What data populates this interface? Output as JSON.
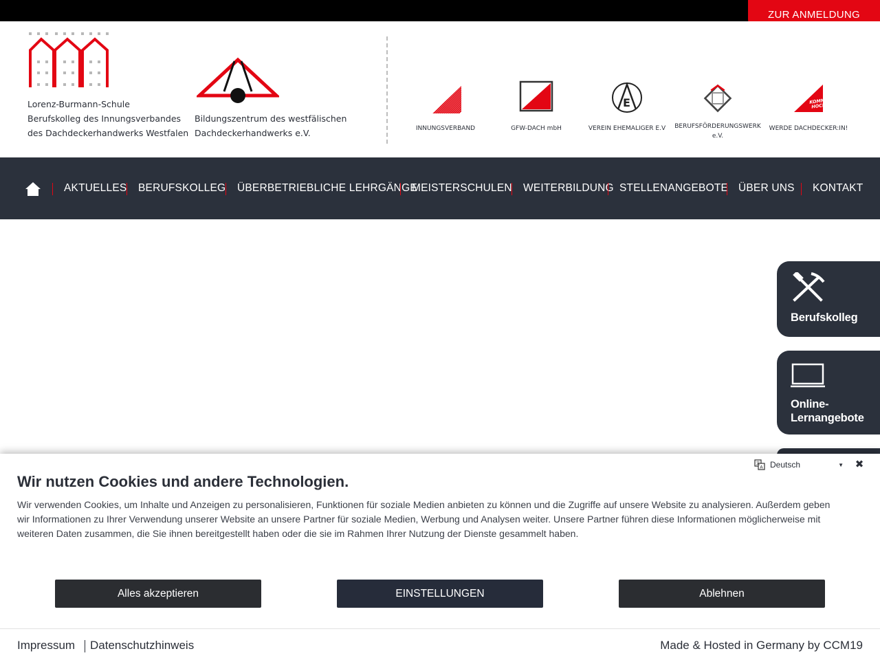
{
  "top": {
    "anmeldung_label": "ZUR ANMELDUNG"
  },
  "header": {
    "school": {
      "line1": "Lorenz-Burmann-Schule",
      "line2": "Berufskolleg des Innungsverbandes",
      "line3": "des Dachdeckerhandwerks Westfalen"
    },
    "center": {
      "line1": "Bildungszentrum des westfälischen",
      "line2": "Dachdeckerhandwerks e.V."
    },
    "partners": [
      {
        "label": "INNUNGSVERBAND",
        "icon": "innungsverband-logo-icon"
      },
      {
        "label": "GFW-DACH mbH",
        "icon": "gfw-dach-logo-icon"
      },
      {
        "label": "VEREIN EHEMALIGER E.V",
        "icon": "verein-ehemaliger-logo-icon"
      },
      {
        "label": "BERUFSFÖRDERUNGSWERK e.V.",
        "icon": "berufsfoerderungswerk-logo-icon"
      },
      {
        "label": "WERDE DACHDECKER:IN!",
        "icon": "komm-hoch-logo-icon",
        "badge_text": "KOMM HOCH!"
      }
    ]
  },
  "nav": {
    "items": [
      {
        "label": "AKTUELLES"
      },
      {
        "label": "BERUFSKOLLEG"
      },
      {
        "label": "ÜBERBETRIEBLICHE LEHRGÄNGE"
      },
      {
        "label": "MEISTERSCHULEN"
      },
      {
        "label": "WEITERBILDUNG"
      },
      {
        "label": "STELLENANGEBOTE"
      },
      {
        "label": "ÜBER UNS"
      },
      {
        "label": "KONTAKT"
      }
    ]
  },
  "side_tabs": [
    {
      "label": "Berufskolleg",
      "icon": "hammer-pick-icon"
    },
    {
      "label_line1": "Online-",
      "label_line2": "Lernangebote",
      "icon": "laptop-icon"
    }
  ],
  "cookie": {
    "title": "Wir nutzen Cookies und andere Technologien.",
    "body": "Wir verwenden Cookies, um Inhalte und Anzeigen zu personalisieren, Funktionen für soziale Medien anbieten zu können und die Zugriffe auf unsere Website zu analysieren. Außerdem geben wir Informationen zu Ihrer Verwendung unserer Website an unsere Partner für soziale Medien, Werbung und Analysen weiter. Unsere Partner führen diese Informationen möglicherweise mit weiteren Daten zusammen, die Sie ihnen bereitgestellt haben oder die sie im Rahmen Ihrer Nutzung der Dienste gesammelt haben.",
    "accept_label": "Alles akzeptieren",
    "settings_label": "EINSTELLUNGEN",
    "decline_label": "Ablehnen",
    "language": "Deutsch",
    "footer": {
      "impressum": "Impressum",
      "datenschutz": "Datenschutzhinweis",
      "made_by": "Made & Hosted in Germany by CCM19"
    }
  },
  "colors": {
    "accent": "#e30613",
    "navy": "#2b313c",
    "black": "#000000"
  }
}
